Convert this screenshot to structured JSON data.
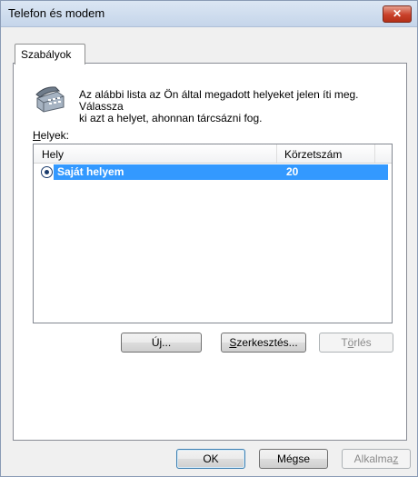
{
  "window": {
    "title": "Telefon és modem",
    "close_symbol": "✕"
  },
  "tabs": [
    {
      "label": "Szabályok",
      "selected": true
    }
  ],
  "rules": {
    "intro_line1": "Az alábbi lista az Ön által megadott helyeket jelen íti meg. Válassza",
    "intro_line2": "ki azt a helyet, ahonnan tárcsázni fog.",
    "places_label_accel": "H",
    "places_label_rest": "elyek:",
    "columns": [
      "Hely",
      "Körzetszám"
    ],
    "rows": [
      {
        "name": "Saját helyem",
        "area_code": "20",
        "selected": true
      }
    ],
    "buttons": {
      "new_a": "Ú",
      "new_b": "j",
      "new_c": "...",
      "edit_a": "S",
      "edit_b": "zerkesztés...",
      "delete_a": "T",
      "delete_b": "ö",
      "delete_c": "rlés"
    }
  },
  "footer": {
    "ok_label": "OK",
    "cancel_label": "Mégse",
    "apply_a": "Alkalma",
    "apply_b": "z"
  },
  "icons": {
    "phone": "phone-icon",
    "radio": "radio-selected-icon"
  },
  "colors": {
    "selection": "#3399ff",
    "title_bar": "#c5d5ea",
    "close_button": "#c9402a"
  }
}
